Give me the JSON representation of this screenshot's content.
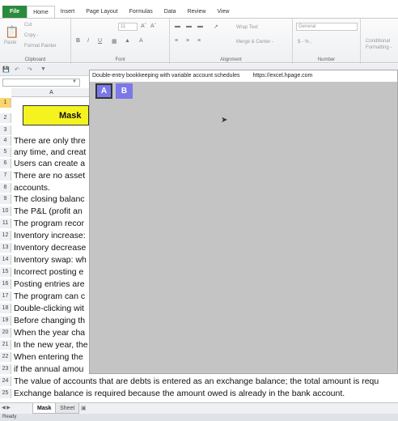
{
  "ribbon_tabs": [
    "File",
    "Home",
    "Insert",
    "Page Layout",
    "Formulas",
    "Data",
    "Review",
    "View"
  ],
  "active_tab": "Home",
  "clipboard": {
    "paste": "Paste",
    "cut": "Cut",
    "copy": "Copy -",
    "format_painter": "Format Painter",
    "label": "Clipboard"
  },
  "font": {
    "size": "11",
    "label": "Font"
  },
  "alignment": {
    "wrap": "Wrap Text",
    "merge": "Merge & Center -",
    "label": "Alignment"
  },
  "number": {
    "format": "General",
    "symbols": "$ - % ,",
    "label": "Number"
  },
  "styles": {
    "conditional": "Conditional",
    "formatting": "Formatting -"
  },
  "column_header": "A",
  "mask_title": "Mask",
  "rows": [
    {
      "num": "1",
      "text": ""
    },
    {
      "num": "2",
      "text": ""
    },
    {
      "num": "3",
      "text": ""
    },
    {
      "num": "4",
      "text": "There are only thre"
    },
    {
      "num": "5",
      "text": "any time, and creat"
    },
    {
      "num": "6",
      "text": "Users can create a"
    },
    {
      "num": "7",
      "text": "There are no asset"
    },
    {
      "num": "8",
      "text": "accounts."
    },
    {
      "num": "9",
      "text": "The closing balanc"
    },
    {
      "num": "10",
      "text": "The P&L (profit an"
    },
    {
      "num": "11",
      "text": "The program recor"
    },
    {
      "num": "12",
      "text": "Inventory increase:"
    },
    {
      "num": "13",
      "text": "Inventory decrease"
    },
    {
      "num": "14",
      "text": "Inventory swap: wh"
    },
    {
      "num": "15",
      "text": "Incorrect posting e"
    },
    {
      "num": "16",
      "text": "Posting entries are"
    },
    {
      "num": "17",
      "text": "The program can c"
    },
    {
      "num": "18",
      "text": "Double-clicking wit"
    },
    {
      "num": "19",
      "text": "Before changing th"
    },
    {
      "num": "20",
      "text": "When the year cha"
    },
    {
      "num": "21",
      "text": "In the new year, the"
    },
    {
      "num": "22",
      "text": "When entering the"
    },
    {
      "num": "23",
      "text": "if the annual amou"
    },
    {
      "num": "24",
      "text": "The value of accounts that are debts is entered as an exchange balance; the total amount is requ"
    },
    {
      "num": "25",
      "text": "Exchange balance is required because the amount owed is already in the bank account."
    }
  ],
  "overlay": {
    "title": "Double-entry bookkeeping with variable account schedules",
    "url": "https://excel.hpage.com",
    "button_a": "A",
    "button_b": "B"
  },
  "sheet_tabs": [
    "Mask",
    "Sheet"
  ],
  "active_sheet": "Mask",
  "status": "Ready"
}
